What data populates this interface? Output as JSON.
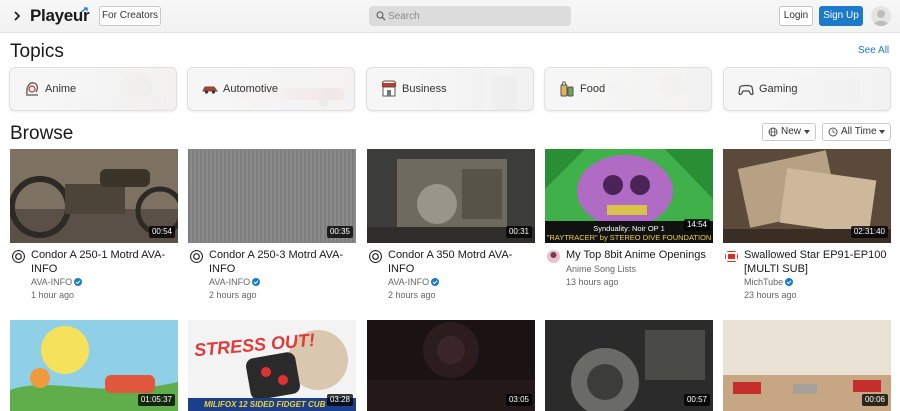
{
  "header": {
    "logo": "Playeur",
    "creators_label": "For Creators",
    "search_placeholder": "Search",
    "login_label": "Login",
    "signup_label": "Sign Up"
  },
  "topics": {
    "heading": "Topics",
    "see_all": "See All",
    "items": [
      {
        "label": "Anime",
        "icon": "anime-icon"
      },
      {
        "label": "Automotive",
        "icon": "car-icon"
      },
      {
        "label": "Business",
        "icon": "store-icon"
      },
      {
        "label": "Food",
        "icon": "food-icon"
      },
      {
        "label": "Gaming",
        "icon": "gamepad-icon"
      }
    ]
  },
  "browse": {
    "heading": "Browse",
    "sort_label": "New",
    "time_label": "All Time"
  },
  "videos": [
    {
      "title": "Condor A 250-1 Motrd AVA-INFO",
      "channel": "AVA-INFO",
      "time": "1 hour ago",
      "duration": "00:54",
      "verified": true
    },
    {
      "title": "Condor A 250-3 Motrd AVA-INFO",
      "channel": "AVA-INFO",
      "time": "2 hours ago",
      "duration": "00:35",
      "verified": true
    },
    {
      "title": "Condor A 350 Motrd AVA-INFO",
      "channel": "AVA-INFO",
      "time": "2 hours ago",
      "duration": "00:31",
      "verified": true
    },
    {
      "title": "My Top 8bit Anime Openings",
      "channel": "Anime Song Lists",
      "time": "13 hours ago",
      "duration": "14:54",
      "verified": false,
      "thumb_caption": "Synduality: Noir OP 1",
      "thumb_caption2": "\"RAYTRACER\" by STEREO DIVE FOUNDATION"
    },
    {
      "title": "Swallowed Star EP91-EP100 [MULTI SUB]",
      "channel": "MichTube",
      "time": "23 hours ago",
      "duration": "02:31:40",
      "verified": true
    },
    {
      "title": "",
      "duration": "01:05:37"
    },
    {
      "title": "",
      "duration": "03:28",
      "thumb_caption": "STRESS OUT!",
      "thumb_caption2": "MILIFOX 12 SIDED FIDGET CUB"
    },
    {
      "title": "",
      "duration": "03:05"
    },
    {
      "title": "",
      "duration": "00:57"
    },
    {
      "title": "",
      "duration": "00:06"
    }
  ]
}
